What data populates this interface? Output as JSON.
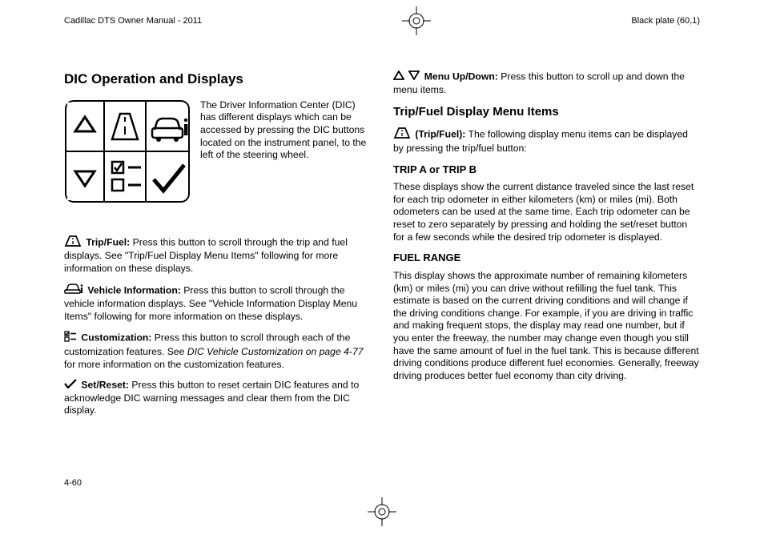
{
  "header": {
    "left": "Cadillac DTS Owner Manual - 2011",
    "right": "Black plate (60,1)"
  },
  "page_number": "4-60",
  "left": {
    "title": "DIC Operation and Displays",
    "intro": "The Driver Information Center (DIC) has different displays which can be accessed by pressing the DIC buttons located on the instrument panel, to the left of the steering wheel.",
    "tripfuel_label": "Trip/Fuel:",
    "tripfuel_text": "Press this button to scroll through the trip and fuel displays. See \"Trip/Fuel Display Menu Items\" following for more information on these displays.",
    "vehicle_label": "Vehicle Information:",
    "vehicle_text": "Press this button to scroll through the vehicle information displays. See \"Vehicle Information Display Menu Items\" following for more information on these displays.",
    "custom_label": "Customization:",
    "custom_text_a": "Press this button to scroll through each of the customization features. See ",
    "custom_text_i": "DIC Vehicle Customization on page 4-77",
    "custom_text_b": " for more information on the customization features.",
    "set_label": "Set/Reset:",
    "set_text": "Press this button to reset certain DIC features and to acknowledge DIC warning messages and clear them from the DIC display."
  },
  "right": {
    "menu_label": "Menu Up/Down:",
    "menu_text": "Press this button to scroll up and down the menu items.",
    "title": "Trip/Fuel Display Menu Items",
    "tripfuel_label": "(Trip/Fuel):",
    "tripfuel_text": "The following display menu items can be displayed by pressing the trip/fuel button:",
    "tripab_title": "TRIP A or TRIP B",
    "tripab_text": "These displays show the current distance traveled since the last reset for each trip odometer in either kilometers (km) or miles (mi). Both odometers can be used at the same time. Each trip odometer can be reset to zero separately by pressing and holding the set/reset button for a few seconds while the desired trip odometer is displayed.",
    "fuelrange_title": "FUEL RANGE",
    "fuelrange_text": "This display shows the approximate number of remaining kilometers (km) or miles (mi) you can drive without refilling the fuel tank. This estimate is based on the current driving conditions and will change if the driving conditions change. For example, if you are driving in traffic and making frequent stops, the display may read one number, but if you enter the freeway, the number may change even though you still have the same amount of fuel in the fuel tank. This is because different driving conditions produce different fuel economies. Generally, freeway driving produces better fuel economy than city driving."
  }
}
